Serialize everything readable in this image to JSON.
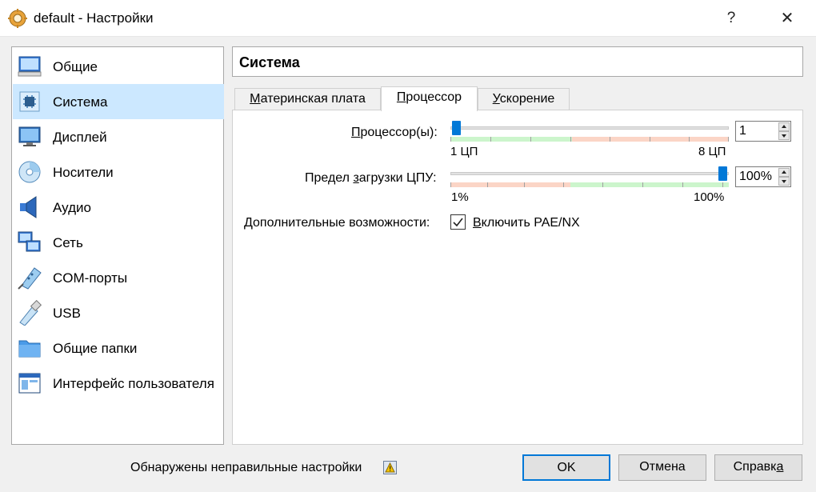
{
  "window": {
    "title": "default - Настройки",
    "help_glyph": "?",
    "close_glyph": "✕"
  },
  "sidebar": {
    "items": [
      {
        "label": "Общие",
        "icon": "general-icon"
      },
      {
        "label": "Система",
        "icon": "system-icon",
        "selected": true
      },
      {
        "label": "Дисплей",
        "icon": "display-icon"
      },
      {
        "label": "Носители",
        "icon": "storage-icon"
      },
      {
        "label": "Аудио",
        "icon": "audio-icon"
      },
      {
        "label": "Сеть",
        "icon": "network-icon"
      },
      {
        "label": "COM-порты",
        "icon": "serial-ports-icon"
      },
      {
        "label": "USB",
        "icon": "usb-icon"
      },
      {
        "label": "Общие папки",
        "icon": "shared-folders-icon"
      },
      {
        "label": "Интерфейс пользователя",
        "icon": "user-interface-icon"
      }
    ]
  },
  "main": {
    "section_title": "Система",
    "tabs": [
      {
        "label_pre": "",
        "label_key": "М",
        "label_post": "атеринская плата"
      },
      {
        "label_pre": "",
        "label_key": "П",
        "label_post": "роцессор",
        "active": true
      },
      {
        "label_pre": "",
        "label_key": "У",
        "label_post": "скорение"
      }
    ],
    "processor": {
      "cpu_label_pre": "",
      "cpu_label_key": "П",
      "cpu_label_post": "роцессор(ы):",
      "cpu_value": "1",
      "cpu_min_label": "1 ЦП",
      "cpu_max_label": "8 ЦП",
      "cpu_min": 1,
      "cpu_max": 8,
      "cap_label_pre": "Предел ",
      "cap_label_key": "з",
      "cap_label_post": "агрузки ЦПУ:",
      "cap_value": "100%",
      "cap_min_label": "1%",
      "cap_max_label": "100%",
      "cap_min": 1,
      "cap_max": 100,
      "cap_level": 100,
      "extended_label": "Дополнительные возможности:",
      "pae_label_pre": "",
      "pae_label_key": "В",
      "pae_label_post": "ключить PAE/NX",
      "pae_checked": true
    }
  },
  "footer": {
    "warning_text": "Обнаружены неправильные настройки",
    "ok_label": "OK",
    "cancel_label": "Отмена",
    "help_pre": "Справк",
    "help_key": "а",
    "help_post": ""
  },
  "colors": {
    "accent": "#0078d7",
    "selection": "#cce8ff",
    "scale_green": "#ccf5cc",
    "scale_red": "#fbd5c6"
  }
}
